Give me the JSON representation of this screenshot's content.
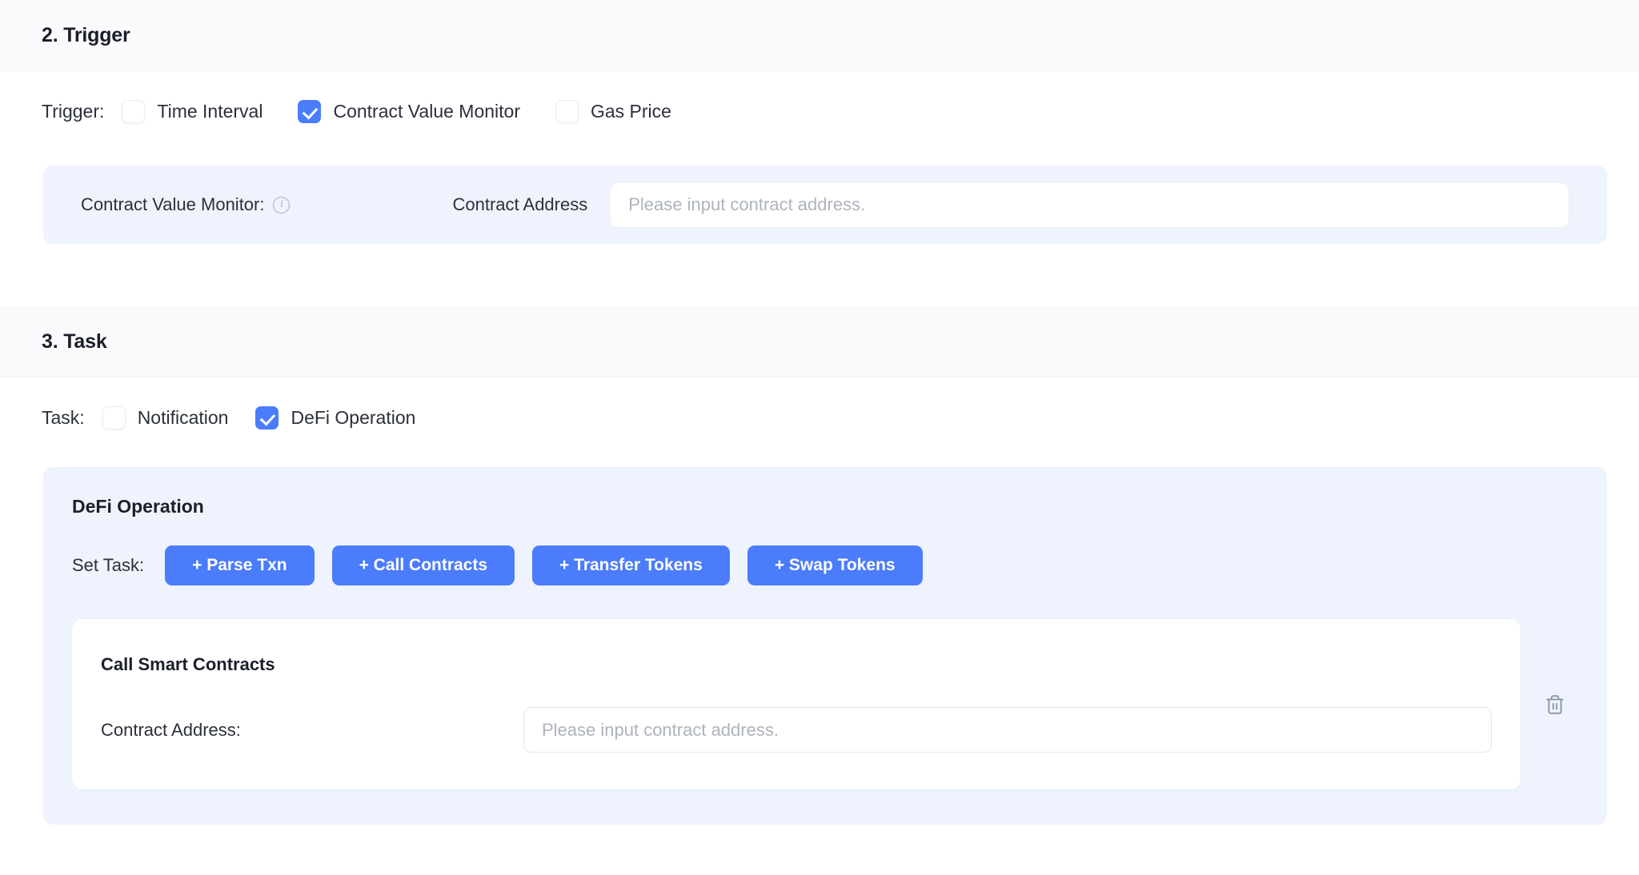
{
  "sections": {
    "trigger": {
      "heading": "2. Trigger",
      "row_label": "Trigger:",
      "options": [
        {
          "label": "Time Interval",
          "checked": false
        },
        {
          "label": "Contract Value Monitor",
          "checked": true
        },
        {
          "label": "Gas Price",
          "checked": false
        }
      ],
      "panel": {
        "label": "Contract Value Monitor:",
        "info_icon": "info-icon",
        "field_label": "Contract Address",
        "input_placeholder": "Please input contract address.",
        "input_value": ""
      }
    },
    "task": {
      "heading": "3. Task",
      "row_label": "Task:",
      "options": [
        {
          "label": "Notification",
          "checked": false
        },
        {
          "label": "DeFi Operation",
          "checked": true
        }
      ],
      "defi": {
        "title": "DeFi Operation",
        "set_task_label": "Set Task:",
        "buttons": [
          {
            "label": "+ Parse Txn"
          },
          {
            "label": "+ Call Contracts"
          },
          {
            "label": "+ Transfer Tokens"
          },
          {
            "label": "+ Swap Tokens"
          }
        ],
        "card": {
          "title": "Call Smart Contracts",
          "field_label": "Contract Address:",
          "input_placeholder": "Please input contract address.",
          "input_value": "",
          "delete_icon": "trash-icon"
        }
      }
    }
  },
  "colors": {
    "accent": "#4b7cfb",
    "panel_bg": "#eef3fd",
    "header_bg": "#fafafc",
    "text": "#2b303b",
    "placeholder": "#aeb3bd"
  }
}
